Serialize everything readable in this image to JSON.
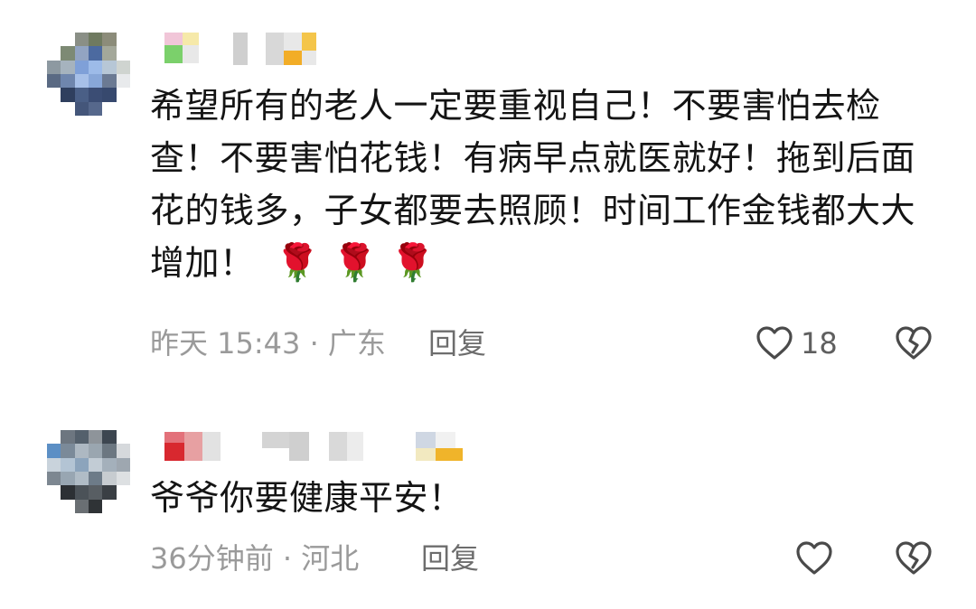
{
  "comments": [
    {
      "text": "希望所有的老人一定要重视自己！不要害怕去检查！不要害怕花钱！有病早点就医就好！拖到后面花的钱多，子女都要去照顾！时间工作金钱都大大增加！",
      "emoji": "🌹🌹🌹",
      "time": "昨天 15:43",
      "location": "广东",
      "reply_label": "回复",
      "like_count": "18",
      "like_icon": "heart-outline-icon",
      "dislike_icon": "broken-heart-icon"
    },
    {
      "text": "爷爷你要健康平安！",
      "time": "36分钟前",
      "location": "河北",
      "reply_label": "回复",
      "like_icon": "heart-outline-icon",
      "dislike_icon": "broken-heart-icon"
    }
  ],
  "colors": {
    "text": "#141414",
    "meta": "#9a9a9a",
    "icon": "#4a4a4a"
  }
}
